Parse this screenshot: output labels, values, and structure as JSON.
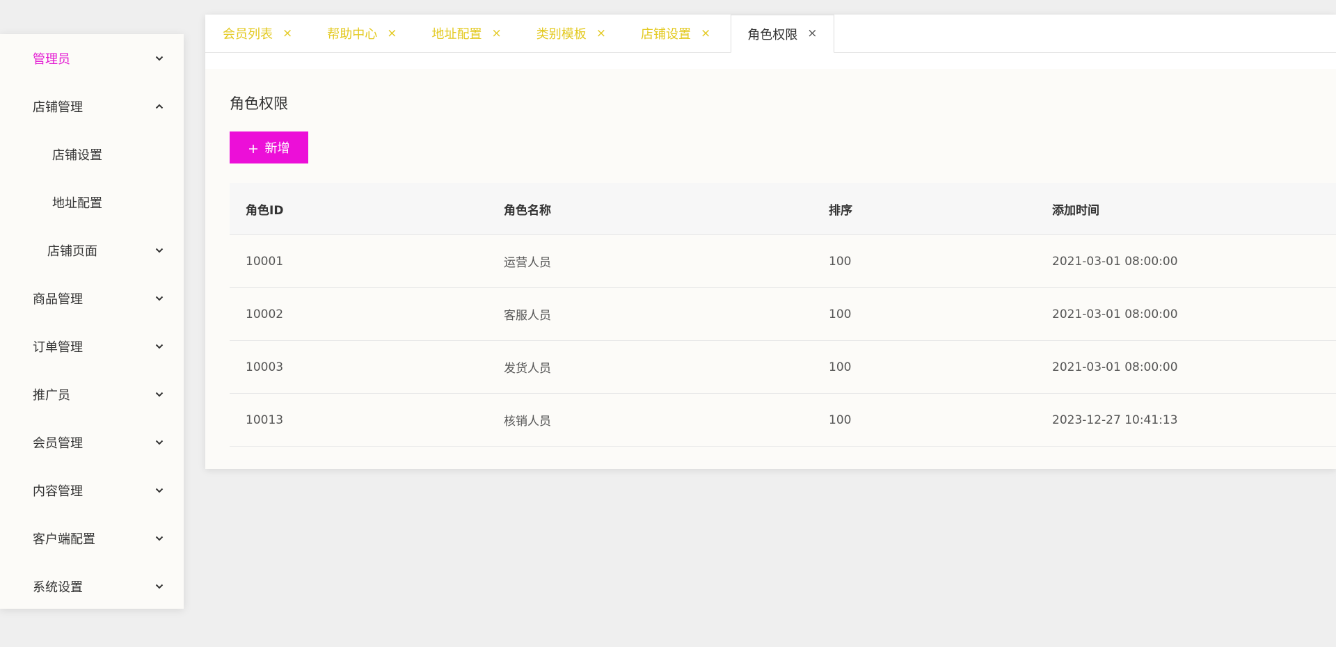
{
  "sidebar": {
    "items": [
      {
        "label": "管理员",
        "arrow": "down"
      },
      {
        "label": "店铺管理",
        "arrow": "up"
      },
      {
        "label": "店铺设置"
      },
      {
        "label": "地址配置"
      },
      {
        "label": "店铺页面",
        "arrow": "down"
      },
      {
        "label": "商品管理",
        "arrow": "down"
      },
      {
        "label": "订单管理",
        "arrow": "down"
      },
      {
        "label": "推广员",
        "arrow": "down"
      },
      {
        "label": "会员管理",
        "arrow": "down"
      },
      {
        "label": "内容管理",
        "arrow": "down"
      },
      {
        "label": "客户端配置",
        "arrow": "down"
      },
      {
        "label": "系统设置",
        "arrow": "down"
      }
    ]
  },
  "tabs": [
    {
      "label": "会员列表",
      "close": "×"
    },
    {
      "label": "帮助中心",
      "close": "×"
    },
    {
      "label": "地址配置",
      "close": "×"
    },
    {
      "label": "类别模板",
      "close": "×"
    },
    {
      "label": "店铺设置",
      "close": "×"
    },
    {
      "label": "角色权限",
      "close": "×",
      "active": true
    }
  ],
  "main": {
    "title": "角色权限",
    "add_label": "新增",
    "table": {
      "headers": [
        "角色ID",
        "角色名称",
        "排序",
        "添加时间"
      ],
      "rows": [
        [
          "10001",
          "运营人员",
          "100",
          "2021-03-01 08:00:00"
        ],
        [
          "10002",
          "客服人员",
          "100",
          "2021-03-01 08:00:00"
        ],
        [
          "10003",
          "发货人员",
          "100",
          "2021-03-01 08:00:00"
        ],
        [
          "10013",
          "核销人员",
          "100",
          "2023-12-27 10:41:13"
        ]
      ]
    }
  },
  "colors": {
    "accent": "#ec0fd8",
    "active_menu": "#e31ad2",
    "tab_text": "#e3c91f"
  }
}
